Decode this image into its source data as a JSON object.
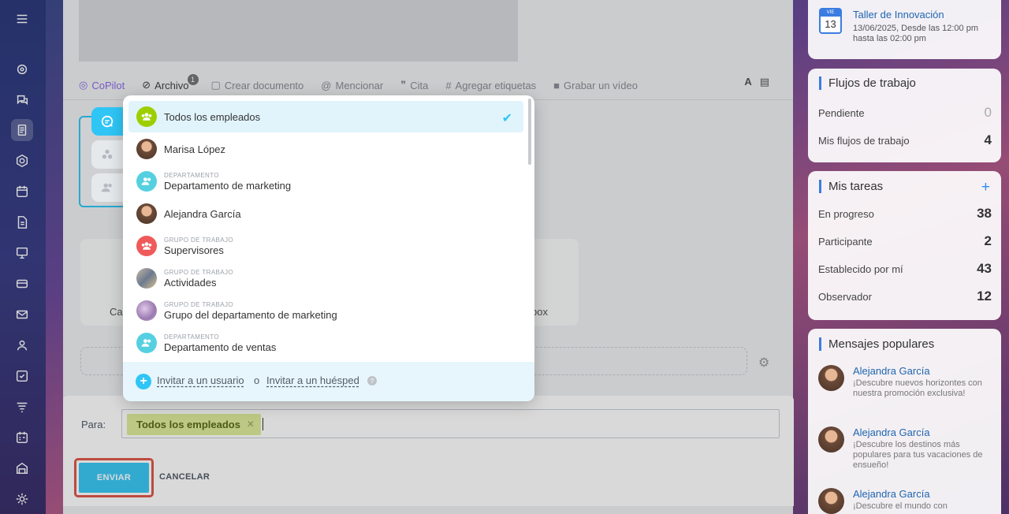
{
  "toolbar": {
    "copilot": "CoPilot",
    "archivo": "Archivo",
    "archivo_count": "1",
    "crear_documento": "Crear documento",
    "mencionar": "Mencionar",
    "cita": "Cita",
    "agregar_etiquetas": "Agregar etiquetas",
    "grabar_video": "Grabar un vídeo",
    "font_a": "A"
  },
  "background": {
    "card_left_text": "Ca",
    "card_right_text": "box"
  },
  "dropdown": {
    "items": [
      {
        "name": "Todos los empleados",
        "sub": "",
        "selected": true
      },
      {
        "name": "Marisa López",
        "sub": ""
      },
      {
        "name": "Departamento de marketing",
        "sub": "DEPARTAMENTO"
      },
      {
        "name": "Alejandra García",
        "sub": ""
      },
      {
        "name": "Supervisores",
        "sub": "GRUPO DE TRABAJO"
      },
      {
        "name": "Actividades",
        "sub": "GRUPO DE TRABAJO"
      },
      {
        "name": "Grupo del departamento de marketing",
        "sub": "GRUPO DE TRABAJO"
      },
      {
        "name": "Departamento de ventas",
        "sub": "DEPARTAMENTO"
      }
    ],
    "footer": {
      "invite_user": "Invitar a un usuario",
      "or": "o",
      "invite_guest": "Invitar a un huésped"
    }
  },
  "composer": {
    "para_label": "Para:",
    "chip": "Todos los empleados",
    "send": "ENVIAR",
    "cancel": "CANCELAR"
  },
  "event": {
    "weekday": "VIE",
    "day": "13",
    "title": "Taller de Innovación",
    "details": "13/06/2025, Desde las 12:00 pm hasta las 02:00 pm"
  },
  "flujos": {
    "title": "Flujos de trabajo",
    "rows": [
      {
        "label": "Pendiente",
        "value": "0"
      },
      {
        "label": "Mis flujos de trabajo",
        "value": "4"
      }
    ]
  },
  "tareas": {
    "title": "Mis tareas",
    "rows": [
      {
        "label": "En progreso",
        "value": "38"
      },
      {
        "label": "Participante",
        "value": "2"
      },
      {
        "label": "Establecido por mí",
        "value": "43"
      },
      {
        "label": "Observador",
        "value": "12"
      }
    ]
  },
  "mensajes": {
    "title": "Mensajes populares",
    "items": [
      {
        "name": "Alejandra García",
        "text": "¡Descubre nuevos horizontes con nuestra promoción exclusiva!"
      },
      {
        "name": "Alejandra García",
        "text": "¡Descubre los destinos más populares para tus vacaciones de ensueño!"
      },
      {
        "name": "Alejandra García",
        "text": "¡Descubre el mundo con"
      }
    ]
  },
  "colors": {
    "accent": "#2fc6f6",
    "send_outline": "#e0584c",
    "chip_bg": "#ddeb9b"
  }
}
